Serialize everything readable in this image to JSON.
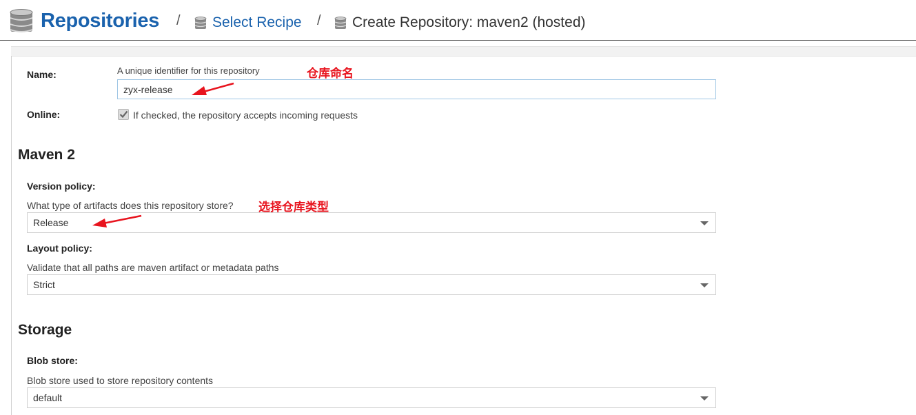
{
  "breadcrumb": {
    "root": "Repositories",
    "separator": "/",
    "link": "Select Recipe",
    "current": "Create Repository: maven2 (hosted)"
  },
  "form": {
    "name": {
      "label": "Name:",
      "help": "A unique identifier for this repository",
      "value": "zyx-release"
    },
    "online": {
      "label": "Online:",
      "checked": true,
      "help": "If checked, the repository accepts incoming requests"
    },
    "maven": {
      "title": "Maven 2",
      "version_policy": {
        "label": "Version policy:",
        "help": "What type of artifacts does this repository store?",
        "value": "Release"
      },
      "layout_policy": {
        "label": "Layout policy:",
        "help": "Validate that all paths are maven artifact or metadata paths",
        "value": "Strict"
      }
    },
    "storage": {
      "title": "Storage",
      "blob_store": {
        "label": "Blob store:",
        "help": "Blob store used to store repository contents",
        "value": "default"
      }
    }
  },
  "annotations": {
    "name_note": "仓库命名",
    "type_note": "选择仓库类型",
    "color": "#e8141e"
  },
  "colors": {
    "brand": "#1a62ad",
    "input_border": "#9fc6e4"
  },
  "icons": {
    "repositories": "database-icon",
    "select_recipe": "database-icon",
    "create_repository": "database-icon",
    "dropdown": "caret-down-icon",
    "checkbox": "checkmark-icon"
  }
}
